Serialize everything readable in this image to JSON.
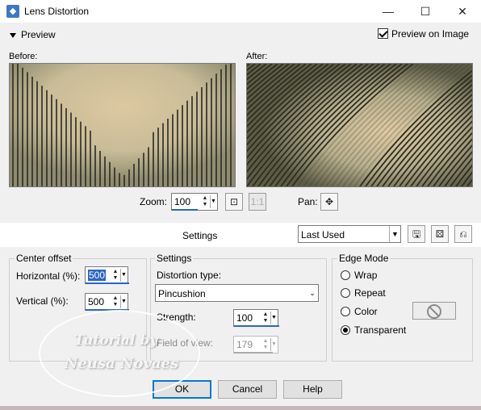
{
  "window": {
    "title": "Lens Distortion",
    "icon": "app-icon",
    "controls": [
      "minimize-icon",
      "maximize-icon",
      "close-icon"
    ]
  },
  "preview": {
    "toggle_label": "Preview",
    "preview_on_image_label": "Preview on Image",
    "preview_on_image_checked": true,
    "before_label": "Before:",
    "after_label": "After:",
    "zoom_label": "Zoom:",
    "zoom_value": "100",
    "pan_label": "Pan:"
  },
  "settings_bar": {
    "label": "Settings",
    "preset_value": "Last Used",
    "icons": [
      "save-preset-icon",
      "randomize-icon",
      "reset-icon"
    ]
  },
  "center_offset": {
    "title": "Center offset",
    "horizontal_label": "Horizontal (%):",
    "horizontal_value": "500",
    "vertical_label": "Vertical (%):",
    "vertical_value": "500"
  },
  "settings": {
    "title": "Settings",
    "distortion_type_label": "Distortion type:",
    "distortion_type_value": "Pincushion",
    "strength_label": "Strength:",
    "strength_value": "100",
    "field_of_view_label": "Field of view:",
    "field_of_view_value": "179"
  },
  "edge_mode": {
    "title": "Edge Mode",
    "options": [
      "Wrap",
      "Repeat",
      "Color",
      "Transparent"
    ],
    "selected": "Transparent"
  },
  "buttons": {
    "ok": "OK",
    "cancel": "Cancel",
    "help": "Help"
  },
  "watermark": {
    "line1": "Tutorial by",
    "line2": "Neusa Novaes"
  },
  "colors": {
    "accent": "#2b64c6",
    "image_light": "#d9c6a0",
    "image_dark": "#3a3a2a"
  }
}
